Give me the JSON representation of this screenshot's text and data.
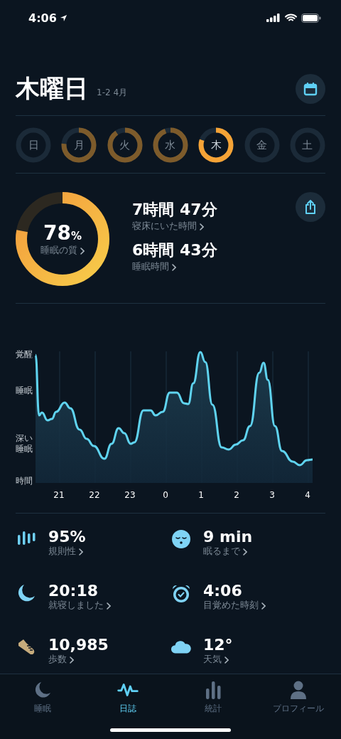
{
  "status_bar": {
    "time": "4:06"
  },
  "header": {
    "title": "木曜日",
    "date_range": "1-2 4月"
  },
  "days": [
    {
      "label": "日",
      "selected": false
    },
    {
      "label": "月",
      "level": 0.76,
      "selected": false
    },
    {
      "label": "火",
      "level": 0.9,
      "selected": false
    },
    {
      "label": "水",
      "level": 0.94,
      "selected": false
    },
    {
      "label": "木",
      "level": 0.8,
      "selected": true
    },
    {
      "label": "金",
      "selected": false
    },
    {
      "label": "土",
      "selected": false
    }
  ],
  "summary": {
    "quality": {
      "value": "78",
      "unit": "%",
      "label": "睡眠の質",
      "level": 0.78
    },
    "stats": [
      {
        "value": "7時間 47分",
        "label": "寝床にいた時間"
      },
      {
        "value": "6時間 43分",
        "label": "睡眠時間"
      }
    ]
  },
  "sleep_chart": {
    "y_labels": [
      "覚醒",
      "睡眠",
      "深い睡眠"
    ],
    "x_axis_title": "時間",
    "x_labels": [
      "21",
      "22",
      "23",
      "0",
      "1",
      "2",
      "3",
      "4"
    ]
  },
  "metrics": [
    {
      "kind": "regularity",
      "value": "95%",
      "label": "規則性"
    },
    {
      "kind": "fall_asleep",
      "value": "9 min",
      "label": "眠るまで"
    },
    {
      "kind": "bedtime",
      "value": "20:18",
      "label": "就寝しました"
    },
    {
      "kind": "wake",
      "value": "4:06",
      "label": "目覚めた時刻"
    },
    {
      "kind": "steps",
      "value": "10,985",
      "label": "歩数"
    },
    {
      "kind": "weather",
      "value": "12°",
      "label": "天気"
    }
  ],
  "tab_bar": [
    {
      "kind": "sleep",
      "label": "睡眠",
      "selected": false
    },
    {
      "kind": "journal",
      "label": "日誌",
      "selected": true
    },
    {
      "kind": "stats",
      "label": "統計",
      "selected": false
    },
    {
      "kind": "profile",
      "label": "プロフィール",
      "selected": false
    }
  ]
}
